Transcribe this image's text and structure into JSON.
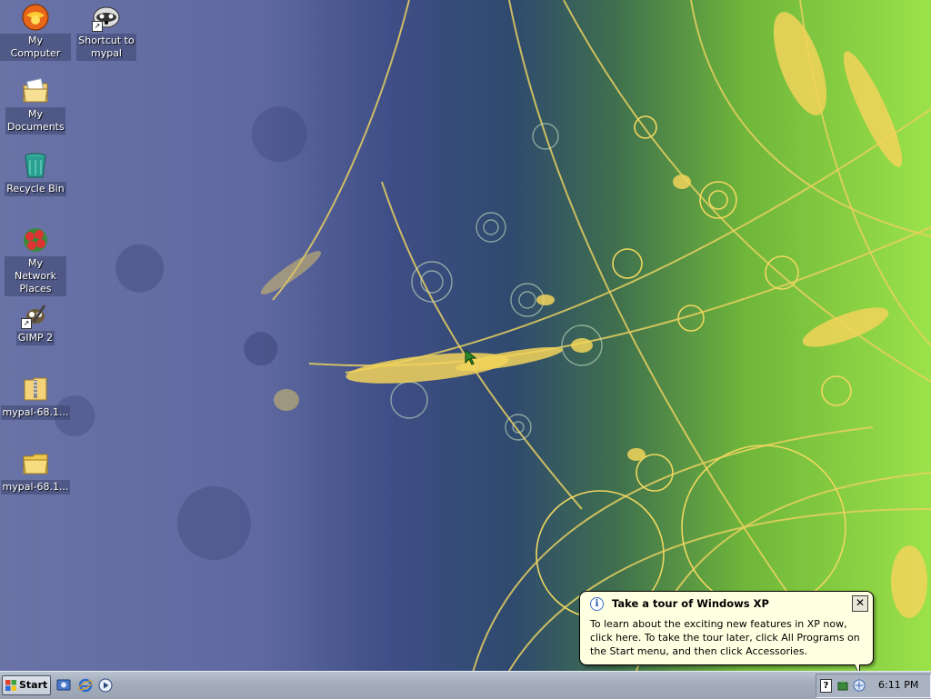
{
  "desktop": {
    "icons": [
      {
        "label": "My Computer"
      },
      {
        "label": "Shortcut to mypal"
      },
      {
        "label": "My Documents"
      },
      {
        "label": "Recycle Bin"
      },
      {
        "label": "My Network Places"
      },
      {
        "label": "GIMP 2"
      },
      {
        "label": "mypal-68.1..."
      },
      {
        "label": "mypal-68.1..."
      }
    ]
  },
  "balloon": {
    "title": "Take a tour of Windows XP",
    "body": "To learn about the exciting new features in XP now, click here. To take the tour later, click All Programs on the Start menu, and then click Accessories.",
    "close_glyph": "✕",
    "info_glyph": "i"
  },
  "taskbar": {
    "start_label": "Start",
    "clock": "6:11 PM",
    "tray_help_glyph": "?"
  },
  "colors": {
    "balloon_bg": "#ffffe1",
    "taskbar": "#a5aebc",
    "wallpaper_accent": "#f2d35a"
  }
}
